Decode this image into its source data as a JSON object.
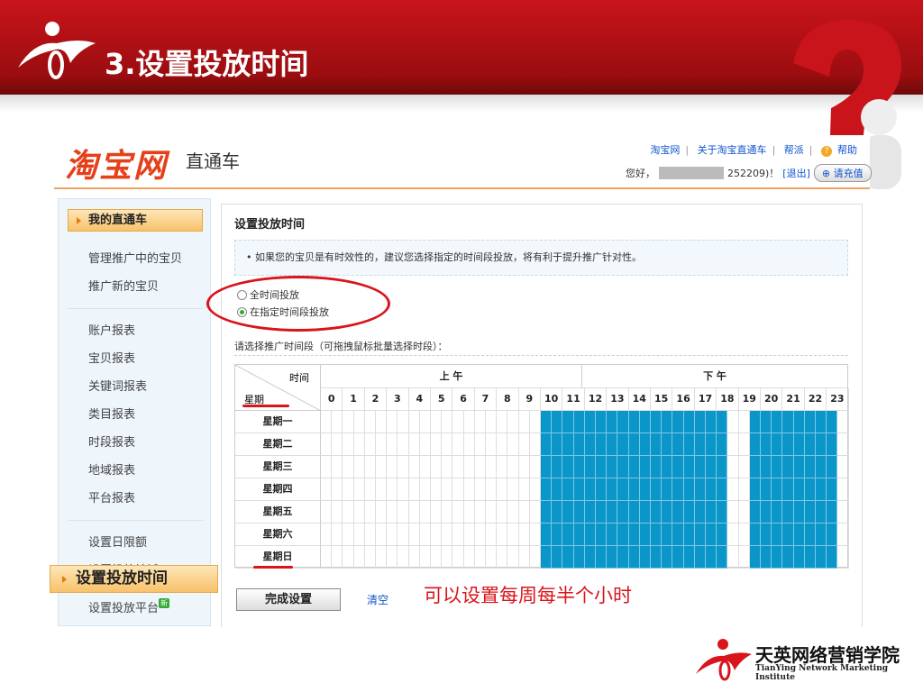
{
  "slide": {
    "title": "3.设置投放时间",
    "annotation": "可以设置每周每半个小时"
  },
  "header": {
    "logo": "淘宝网",
    "product": "直通车",
    "links": [
      "淘宝网",
      "关于淘宝直通车",
      "帮派",
      "帮助"
    ],
    "greeting": "您好，",
    "user_suffix": "252209)！",
    "logout": "[退出]",
    "recharge": "请充值"
  },
  "sidebar": {
    "head": "我的直通车",
    "groups": [
      [
        "管理推广中的宝贝",
        "推广新的宝贝"
      ],
      [
        "账户报表",
        "宝贝报表",
        "关键词报表",
        "类目报表",
        "时段报表",
        "地域报表",
        "平台报表"
      ],
      [
        "设置日限额",
        "设置投放地域"
      ]
    ],
    "active": "设置投放时间",
    "last": "设置投放平台",
    "new_badge": "新"
  },
  "main": {
    "title": "设置投放时间",
    "tip": "• 如果您的宝贝是有时效性的，建议您选择指定的时间段投放，将有利于提升推广针对性。",
    "radios": [
      {
        "label": "全时间投放",
        "checked": false
      },
      {
        "label": "在指定时间段投放",
        "checked": true
      }
    ],
    "pick_label": "请选择推广时间段（可拖拽鼠标批量选择时段）：",
    "grid": {
      "corner_time": "时间",
      "corner_day": "星期",
      "am": "上 午",
      "pm": "下 午",
      "hours": [
        "0",
        "1",
        "2",
        "3",
        "4",
        "5",
        "6",
        "7",
        "8",
        "9",
        "10",
        "11",
        "12",
        "13",
        "14",
        "15",
        "16",
        "17",
        "18",
        "19",
        "20",
        "21",
        "22",
        "23"
      ],
      "days": [
        "星期一",
        "星期二",
        "星期三",
        "星期四",
        "星期五",
        "星期六",
        "星期日"
      ],
      "selected_half_hour_ranges": [
        [
          20,
          36
        ],
        [
          39,
          46
        ]
      ],
      "selected_color": "#0b96c9"
    },
    "done": "完成设置",
    "clear": "清空"
  },
  "footer": {
    "cn": "天英网络营销学院",
    "en": "TianYing Network Marketing Institute"
  }
}
